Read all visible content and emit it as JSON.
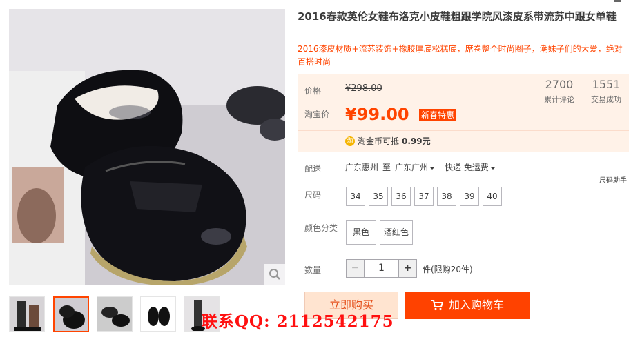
{
  "product": {
    "title": "2016春款英伦女鞋布洛克小皮鞋粗跟学院风漆皮系带流苏中跟女单鞋",
    "subtitle": "2016漆皮材质+流苏装饰+橡胶厚底松糕底，席卷整个时尚圈子，潮妹子们的大爱，绝对百搭时尚"
  },
  "price": {
    "orig_label": "价格",
    "orig_value": "¥298.00",
    "tb_label": "淘宝价",
    "tb_value": "¥99.00",
    "promo_tag": "新春特惠",
    "coin_icon": "淘",
    "coin_text": "淘金币可抵",
    "coin_amount": "0.99元"
  },
  "stats": {
    "reviews_num": "2700",
    "reviews_label": "累计评论",
    "sales_num": "1551",
    "sales_label": "交易成功"
  },
  "shipping": {
    "label": "配送",
    "from": "广东惠州",
    "to_word": "至",
    "to": "广东广州",
    "method": "快递 免运费"
  },
  "size": {
    "label": "尺码",
    "helper": "尺码助手",
    "options": [
      "34",
      "35",
      "36",
      "37",
      "38",
      "39",
      "40"
    ]
  },
  "color": {
    "label": "颜色分类",
    "options": [
      "黑色",
      "酒红色"
    ]
  },
  "quantity": {
    "label": "数量",
    "minus": "−",
    "value": "1",
    "plus": "+",
    "unit": "件(限购20件)"
  },
  "actions": {
    "buy_now": "立即购买",
    "add_cart": "加入购物车"
  },
  "contact": "联系QQ: 2112542175",
  "colors": {
    "accent": "#ff4400",
    "price_bg": "#fff2e8",
    "cart_btn": "#ff4200",
    "buy_btn_bg": "#ffe4d0"
  }
}
